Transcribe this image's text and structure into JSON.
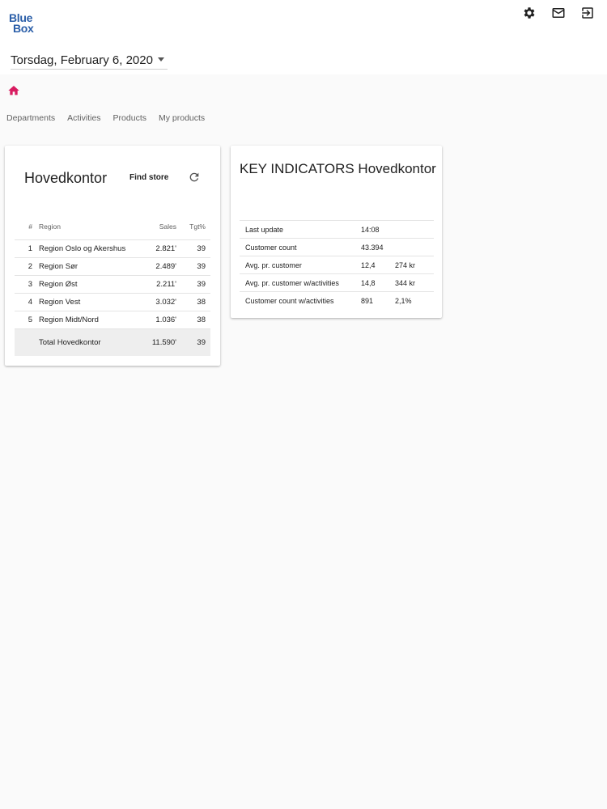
{
  "brand": {
    "line1": "Blue",
    "line2": "Box"
  },
  "icons": {
    "settings": "gear-icon",
    "mail": "mail-icon",
    "logout": "logout-icon",
    "home": "home-icon",
    "refresh": "refresh-icon"
  },
  "colors": {
    "brand": "#2a5ea8",
    "home_accent": "#d81b60"
  },
  "date_picker": {
    "value": "Torsdag, February 6, 2020"
  },
  "tabs": [
    {
      "label": "Departments"
    },
    {
      "label": "Activities"
    },
    {
      "label": "Products"
    },
    {
      "label": "My products"
    }
  ],
  "left_card": {
    "title": "Hovedkontor",
    "find_store_label": "Find store",
    "columns": {
      "num": "#",
      "region": "Region",
      "sales": "Sales",
      "tgt": "Tgt%"
    },
    "rows": [
      {
        "num": "1",
        "region": "Region Oslo og Akershus",
        "sales": "2.821'",
        "tgt": "39"
      },
      {
        "num": "2",
        "region": "Region Sør",
        "sales": "2.489'",
        "tgt": "39"
      },
      {
        "num": "3",
        "region": "Region Øst",
        "sales": "2.211'",
        "tgt": "39"
      },
      {
        "num": "4",
        "region": "Region Vest",
        "sales": "3.032'",
        "tgt": "38"
      },
      {
        "num": "5",
        "region": "Region Midt/Nord",
        "sales": "1.036'",
        "tgt": "38"
      }
    ],
    "total": {
      "label": "Total Hovedkontor",
      "sales": "11.590'",
      "tgt": "39"
    }
  },
  "right_card": {
    "title": "KEY INDICATORS Hovedkontor",
    "rows": [
      {
        "label": "Last update",
        "v1": "14:08",
        "v2": ""
      },
      {
        "label": "Customer count",
        "v1": "43.394",
        "v2": ""
      },
      {
        "label": "Avg. pr. customer",
        "v1": "12,4",
        "v2": "274 kr"
      },
      {
        "label": "Avg. pr. customer w/activities",
        "v1": "14,8",
        "v2": "344 kr"
      },
      {
        "label": "Customer count w/activities",
        "v1": "891",
        "v2": "2,1%"
      }
    ]
  }
}
